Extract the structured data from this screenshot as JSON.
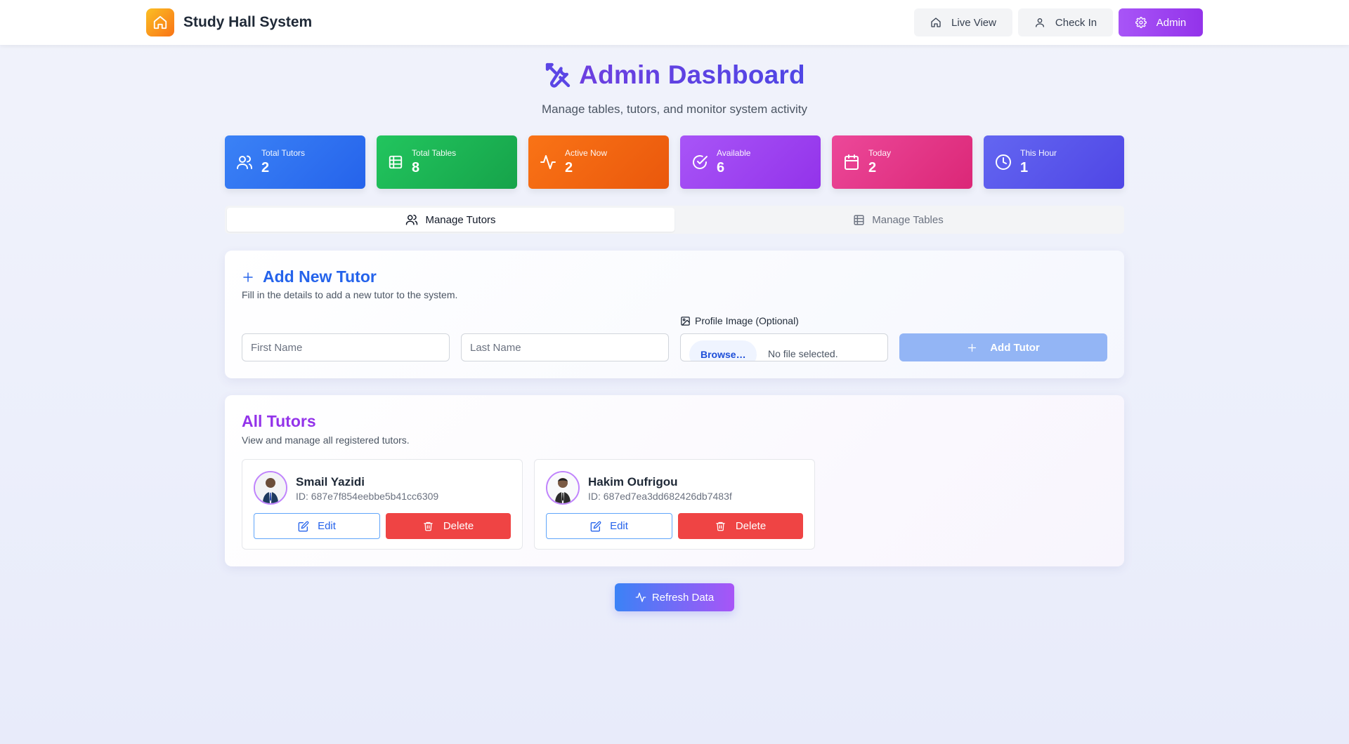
{
  "app": {
    "name": "Study Hall System",
    "logo_icon": "home-icon"
  },
  "nav": {
    "live_view": "Live View",
    "check_in": "Check In",
    "admin": "Admin"
  },
  "header": {
    "title": "Admin Dashboard",
    "subtitle": "Manage tables, tutors, and monitor system activity",
    "icon": "tools-icon"
  },
  "stats": [
    {
      "label": "Total Tutors",
      "value": "2",
      "icon": "users-icon",
      "color": "#2563eb"
    },
    {
      "label": "Total Tables",
      "value": "8",
      "icon": "table-icon",
      "color": "#16a34a"
    },
    {
      "label": "Active Now",
      "value": "2",
      "icon": "activity-icon",
      "color": "#ea580c"
    },
    {
      "label": "Available",
      "value": "6",
      "icon": "check-circle-icon",
      "color": "#9333ea"
    },
    {
      "label": "Today",
      "value": "2",
      "icon": "calendar-icon",
      "color": "#db2777"
    },
    {
      "label": "This Hour",
      "value": "1",
      "icon": "clock-icon",
      "color": "#4f46e5"
    }
  ],
  "tabs": [
    {
      "label": "Manage Tutors",
      "active": true
    },
    {
      "label": "Manage Tables",
      "active": false
    }
  ],
  "add_tutor": {
    "title": "Add New Tutor",
    "description": "Fill in the details to add a new tutor to the system.",
    "first_name_placeholder": "First Name",
    "last_name_placeholder": "Last Name",
    "image_label": "Profile Image (Optional)",
    "browse_label": "Browse…",
    "file_status": "No file selected.",
    "submit_label": "Add Tutor"
  },
  "all_tutors": {
    "title": "All Tutors",
    "description": "View and manage all registered tutors.",
    "edit_label": "Edit",
    "delete_label": "Delete",
    "tutors": [
      {
        "name": "Smail Yazidi",
        "id": "ID: 687e7f854eebbe5b41cc6309"
      },
      {
        "name": "Hakim Oufrigou",
        "id": "ID: 687ed7ea3dd682426db7483f"
      }
    ]
  },
  "refresh_label": "Refresh Data"
}
